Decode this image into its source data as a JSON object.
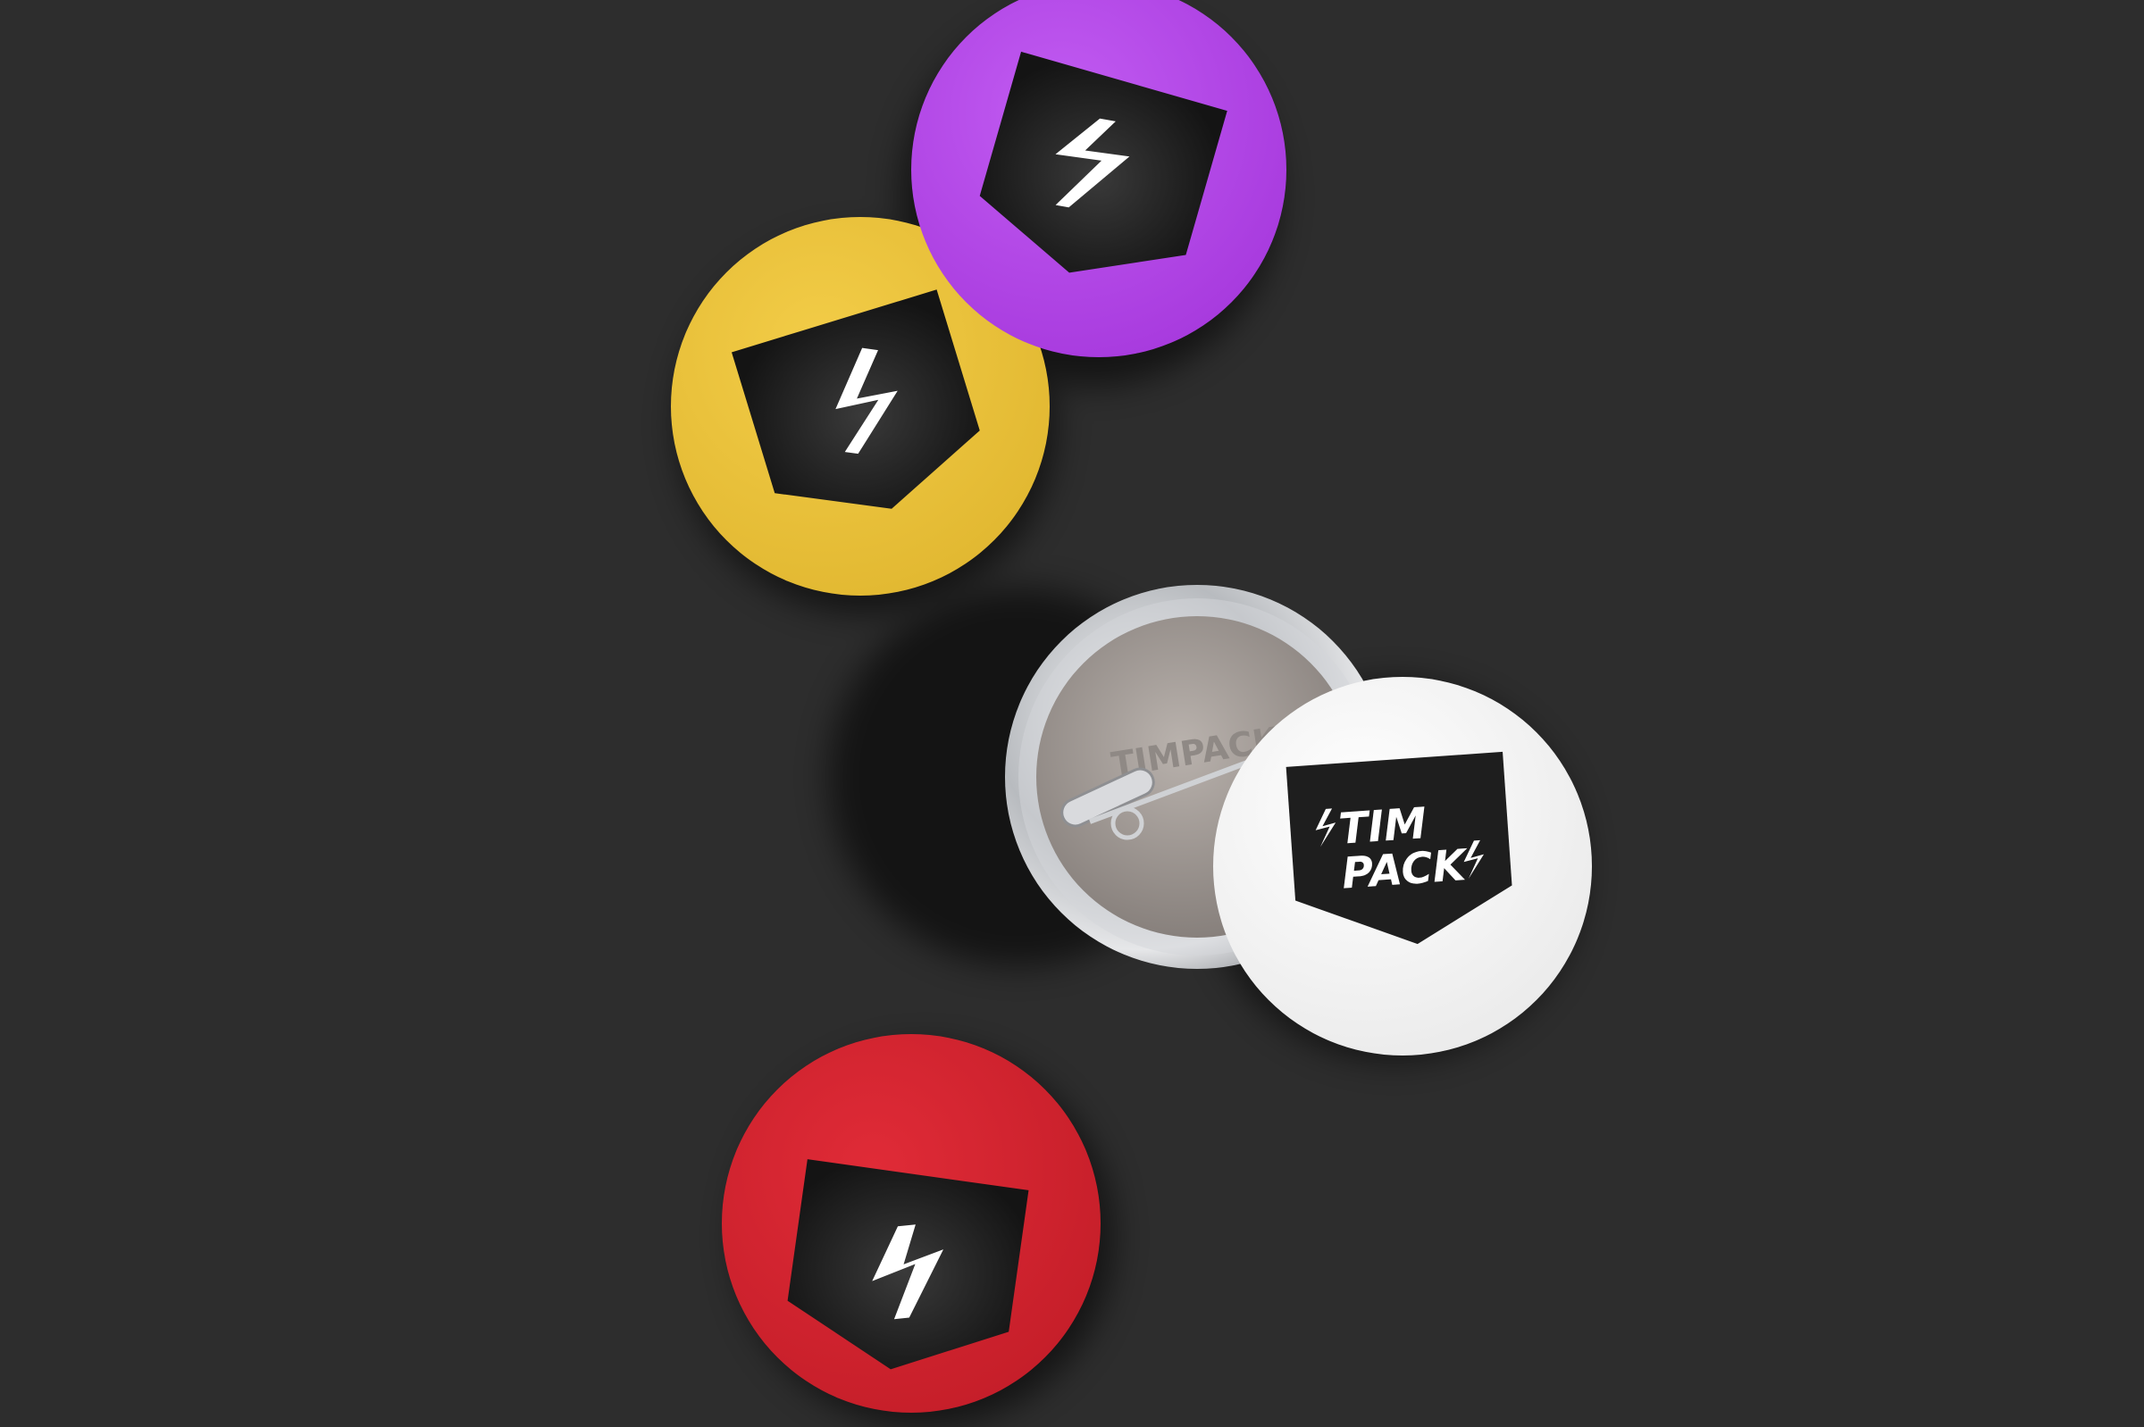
{
  "colors": {
    "background": "#2d2d2d",
    "purple": "#b446e8",
    "yellow": "#eac23c",
    "red": "#d3232e",
    "white": "#f2f2f2",
    "shield": "#1f1f1f",
    "metal": "#c7c9cc"
  },
  "buttons": [
    {
      "id": "purple",
      "icon": "lightning-bolt-icon"
    },
    {
      "id": "yellow",
      "icon": "lightning-bolt-icon"
    },
    {
      "id": "white",
      "icon": "stimpacks-logo"
    },
    {
      "id": "red",
      "icon": "lightning-bolt-icon"
    }
  ],
  "logo": {
    "line1": "TIM",
    "line2": "PACK",
    "back_mark": "TIMPACK"
  }
}
